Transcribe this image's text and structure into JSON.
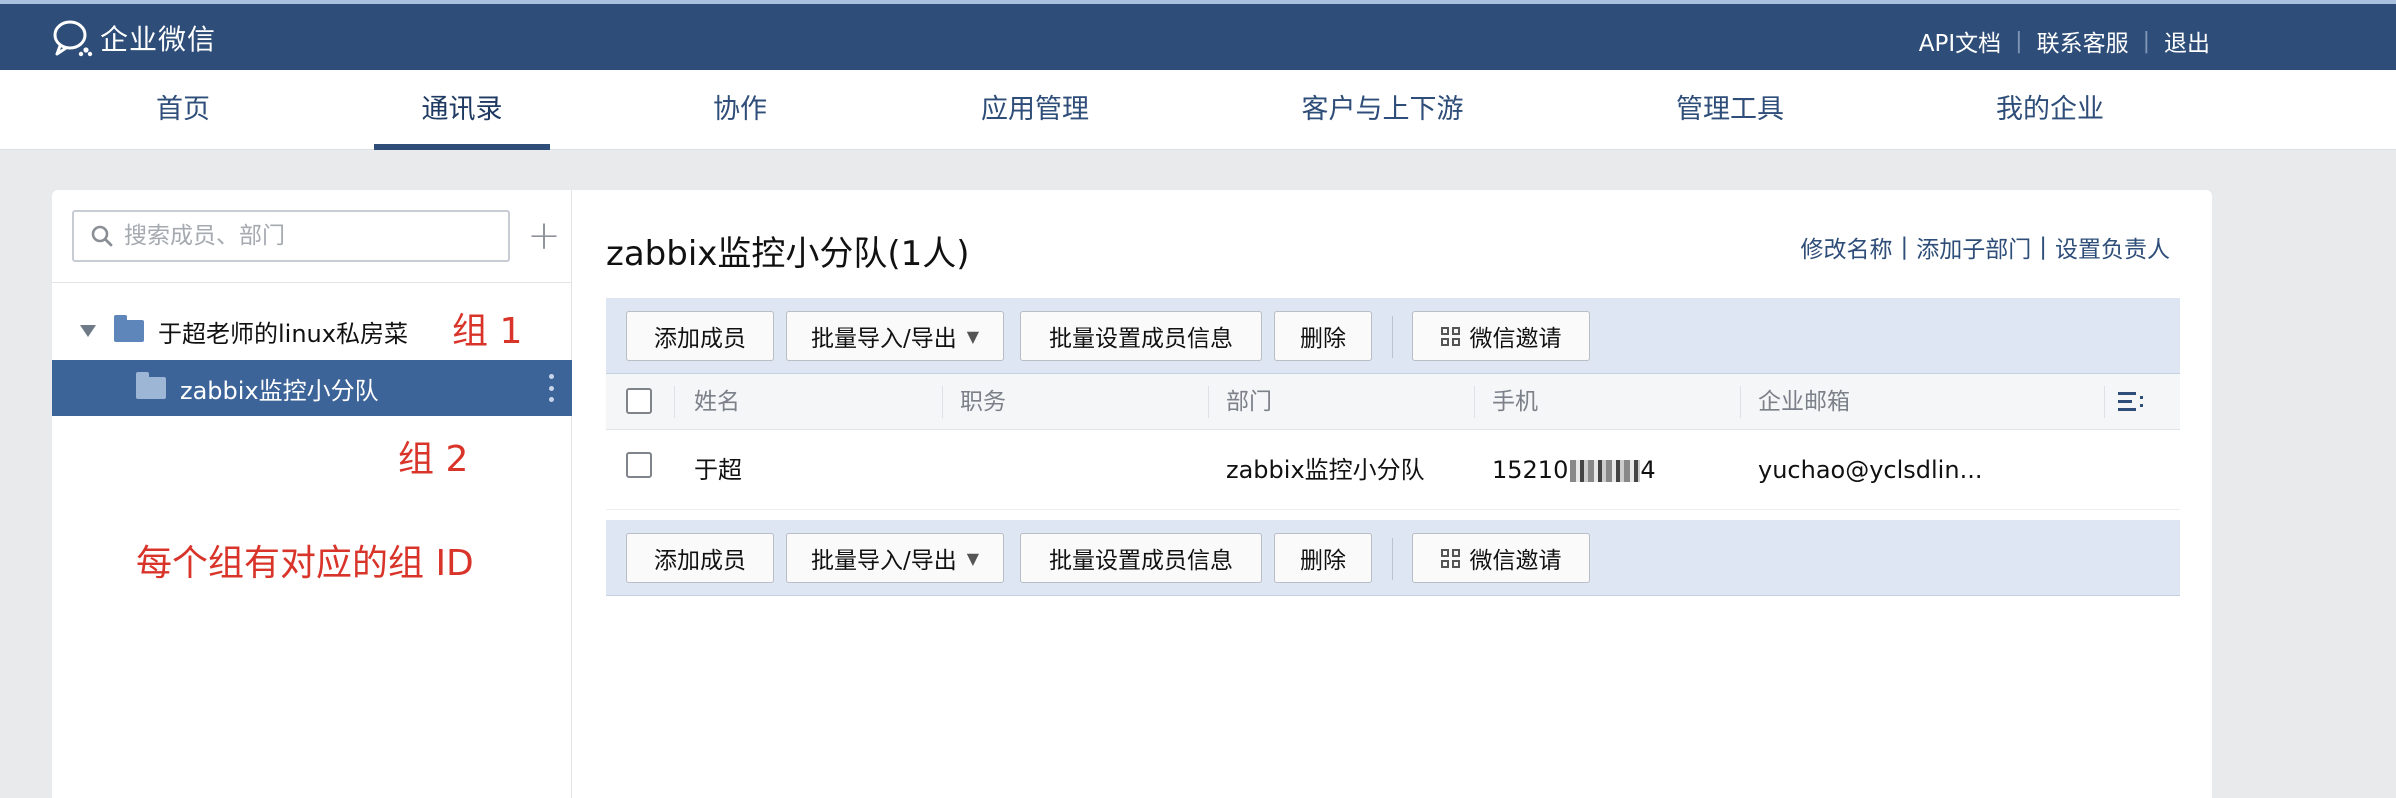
{
  "app": {
    "name": "企业微信"
  },
  "top_links": [
    "API文档",
    "联系客服",
    "退出"
  ],
  "nav": {
    "tabs": [
      {
        "label": "首页"
      },
      {
        "label": "通讯录",
        "active": true
      },
      {
        "label": "协作"
      },
      {
        "label": "应用管理"
      },
      {
        "label": "客户与上下游"
      },
      {
        "label": "管理工具"
      },
      {
        "label": "我的企业"
      }
    ]
  },
  "sidebar": {
    "search_placeholder": "搜索成员、部门",
    "add_symbol": "+",
    "root": {
      "label": "于超老师的linux私房菜"
    },
    "child": {
      "label": "zabbix监控小分队",
      "selected": true
    }
  },
  "annotations": {
    "group1": "组 1",
    "group2": "组 2",
    "note": "每个组有对应的组 ID"
  },
  "department": {
    "title": "zabbix监控小分队(1人)",
    "actions": [
      "修改名称",
      "添加子部门",
      "设置负责人"
    ]
  },
  "toolbar": {
    "add_member": "添加成员",
    "import_export": "批量导入/导出",
    "batch_set": "批量设置成员信息",
    "delete": "删除",
    "wechat_invite": "微信邀请",
    "dropdown_arrow": "▼"
  },
  "table": {
    "columns": [
      "姓名",
      "职务",
      "部门",
      "手机",
      "企业邮箱"
    ],
    "rows": [
      {
        "name": "于超",
        "title": "",
        "dept": "zabbix监控小分队",
        "phone_prefix": "15210",
        "phone_suffix": "4",
        "email": "yuchao@yclsdlin..."
      }
    ]
  },
  "colors": {
    "header_bg": "#2e4d78",
    "selected_bg": "#3d6499",
    "toolbar_bg": "#dde6f2",
    "annotation": "#d8342a"
  }
}
